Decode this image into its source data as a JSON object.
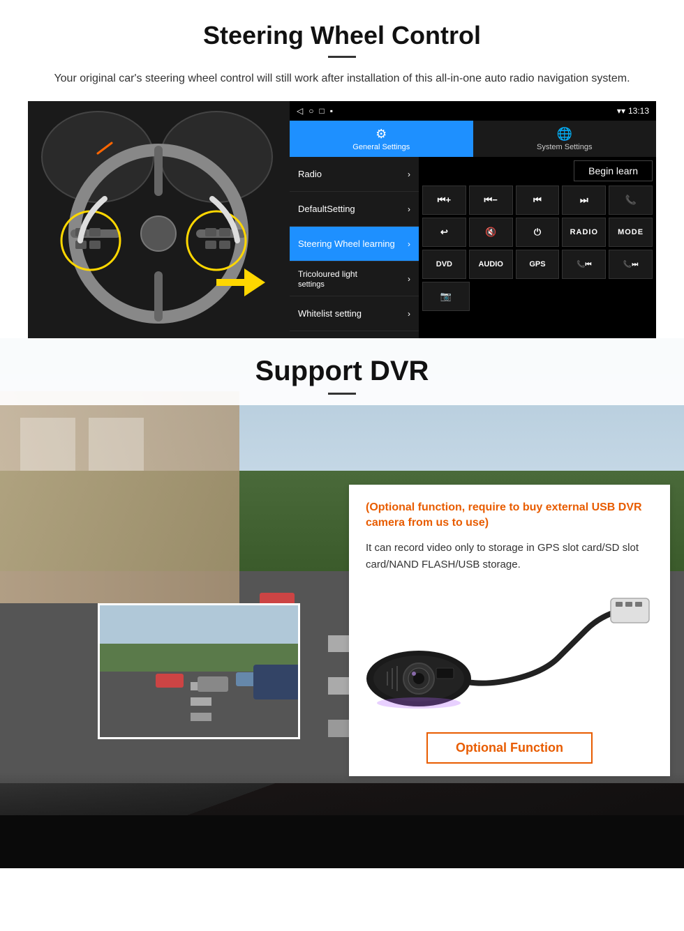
{
  "steering": {
    "title": "Steering Wheel Control",
    "subtitle": "Your original car's steering wheel control will still work after installation of this all-in-one auto radio navigation system.",
    "statusbar": {
      "time": "13:13",
      "nav_back": "◁",
      "nav_home": "○",
      "nav_recent": "□",
      "nav_menu": "▪"
    },
    "tabs": {
      "general": "General Settings",
      "system": "System Settings"
    },
    "menu": {
      "items": [
        {
          "label": "Radio",
          "active": false
        },
        {
          "label": "DefaultSetting",
          "active": false
        },
        {
          "label": "Steering Wheel learning",
          "active": true
        },
        {
          "label": "Tricoloured light settings",
          "active": false
        },
        {
          "label": "Whitelist setting",
          "active": false
        }
      ]
    },
    "controls": {
      "begin_learn": "Begin learn",
      "row1": [
        "⏮+",
        "⏮−",
        "⏮⏮",
        "⏭⏭",
        "📞"
      ],
      "row2": [
        "↩",
        "🔇",
        "⏻",
        "RADIO",
        "MODE"
      ],
      "row3": [
        "DVD",
        "AUDIO",
        "GPS",
        "📞⏮",
        "📞⏭"
      ],
      "row4": [
        "📷"
      ]
    }
  },
  "dvr": {
    "title": "Support DVR",
    "optional_notice": "(Optional function, require to buy external USB DVR camera from us to use)",
    "description": "It can record video only to storage in GPS slot card/SD slot card/NAND FLASH/USB storage.",
    "optional_button": "Optional Function"
  }
}
